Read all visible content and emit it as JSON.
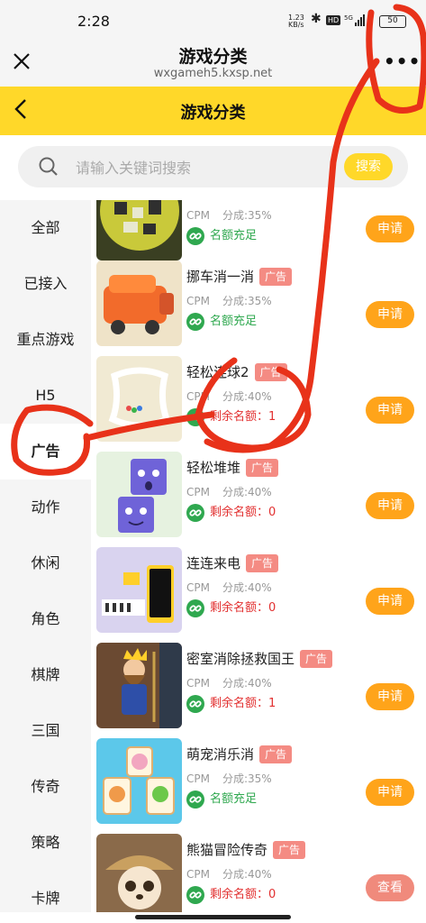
{
  "status_bar": {
    "time": "2:28",
    "network_speed": "1.23\nKB/s",
    "hd_badge": "HD",
    "battery": "50"
  },
  "wechat_header": {
    "title": "游戏分类",
    "url": "wxgameh5.kxsp.net"
  },
  "app_header": {
    "title": "游戏分类"
  },
  "search": {
    "placeholder": "请输入关键词搜索",
    "button_label": "搜索"
  },
  "sidebar": {
    "items": [
      {
        "label": "全部"
      },
      {
        "label": "已接入"
      },
      {
        "label": "重点游戏"
      },
      {
        "label": "H5"
      },
      {
        "label": "广告",
        "active": true
      },
      {
        "label": "动作"
      },
      {
        "label": "休闲"
      },
      {
        "label": "角色"
      },
      {
        "label": "棋牌"
      },
      {
        "label": "三国"
      },
      {
        "label": "传奇"
      },
      {
        "label": "策略"
      },
      {
        "label": "卡牌"
      }
    ]
  },
  "games": [
    {
      "name": "",
      "tag": "",
      "cpm": "CPM",
      "share": "分成:35%",
      "quota": "名额充足",
      "quota_status": "ok",
      "action": "申请"
    },
    {
      "name": "挪车消一消",
      "tag": "广告",
      "cpm": "CPM",
      "share": "分成:35%",
      "quota": "名额充足",
      "quota_status": "ok",
      "action": "申请"
    },
    {
      "name": "轻松连球2",
      "tag": "广告",
      "cpm": "CPM",
      "share": "分成:40%",
      "quota": "剩余名额：1",
      "quota_status": "warn",
      "action": "申请"
    },
    {
      "name": "轻松堆堆",
      "tag": "广告",
      "cpm": "CPM",
      "share": "分成:40%",
      "quota": "剩余名额：0",
      "quota_status": "warn",
      "action": "申请"
    },
    {
      "name": "连连来电",
      "tag": "广告",
      "cpm": "CPM",
      "share": "分成:40%",
      "quota": "剩余名额：0",
      "quota_status": "warn",
      "action": "申请"
    },
    {
      "name": "密室消除拯救国王",
      "tag": "广告",
      "cpm": "CPM",
      "share": "分成:40%",
      "quota": "剩余名额：1",
      "quota_status": "warn",
      "action": "申请"
    },
    {
      "name": "萌宠消乐消",
      "tag": "广告",
      "cpm": "CPM",
      "share": "分成:35%",
      "quota": "名额充足",
      "quota_status": "ok",
      "action": "申请"
    },
    {
      "name": "熊猫冒险传奇",
      "tag": "广告",
      "cpm": "CPM",
      "share": "分成:40%",
      "quota": "剩余名额：0",
      "quota_status": "warn",
      "action": "查看"
    }
  ],
  "colors": {
    "brand_yellow": "#ffd829",
    "apply_orange": "#ffa41a",
    "ok_green": "#2fa84f",
    "warn_red": "#e23030",
    "ad_tag": "#f48b83",
    "annotation_red": "#e8321a"
  },
  "annotations": {
    "note": "red hand-drawn circles around the menu button, the 广告 tab and the 轻松连球2 card"
  }
}
